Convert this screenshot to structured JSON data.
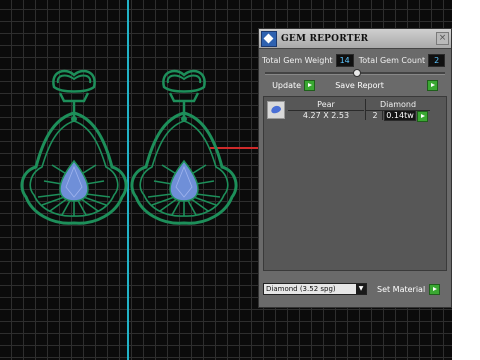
{
  "panel": {
    "title": "GEM REPORTER",
    "close_glyph": "×",
    "total_weight_label": "Total Gem Weight",
    "total_weight_value": "14",
    "total_count_label": "Total Gem Count",
    "total_count_value": "2",
    "update_label": "Update",
    "save_report_label": "Save Report",
    "gems": [
      {
        "shape": "Pear",
        "size": "4.27 X 2.53",
        "material": "Diamond",
        "count": "2",
        "weight": "0.14tw"
      }
    ],
    "material_select_value": "Diamond   (3.52 spg)",
    "set_material_label": "Set Material"
  },
  "colors": {
    "jewelry_outline": "#1d8f5a",
    "gem_fill": "#6f8fd8",
    "axis_cyan": "#21b3c7",
    "axis_red": "#cf2a2a"
  },
  "icons": {
    "logo": "gem-reporter-logo-icon",
    "close": "close-icon",
    "go": "green-arrow-icon",
    "dropdown": "chevron-down-icon"
  }
}
